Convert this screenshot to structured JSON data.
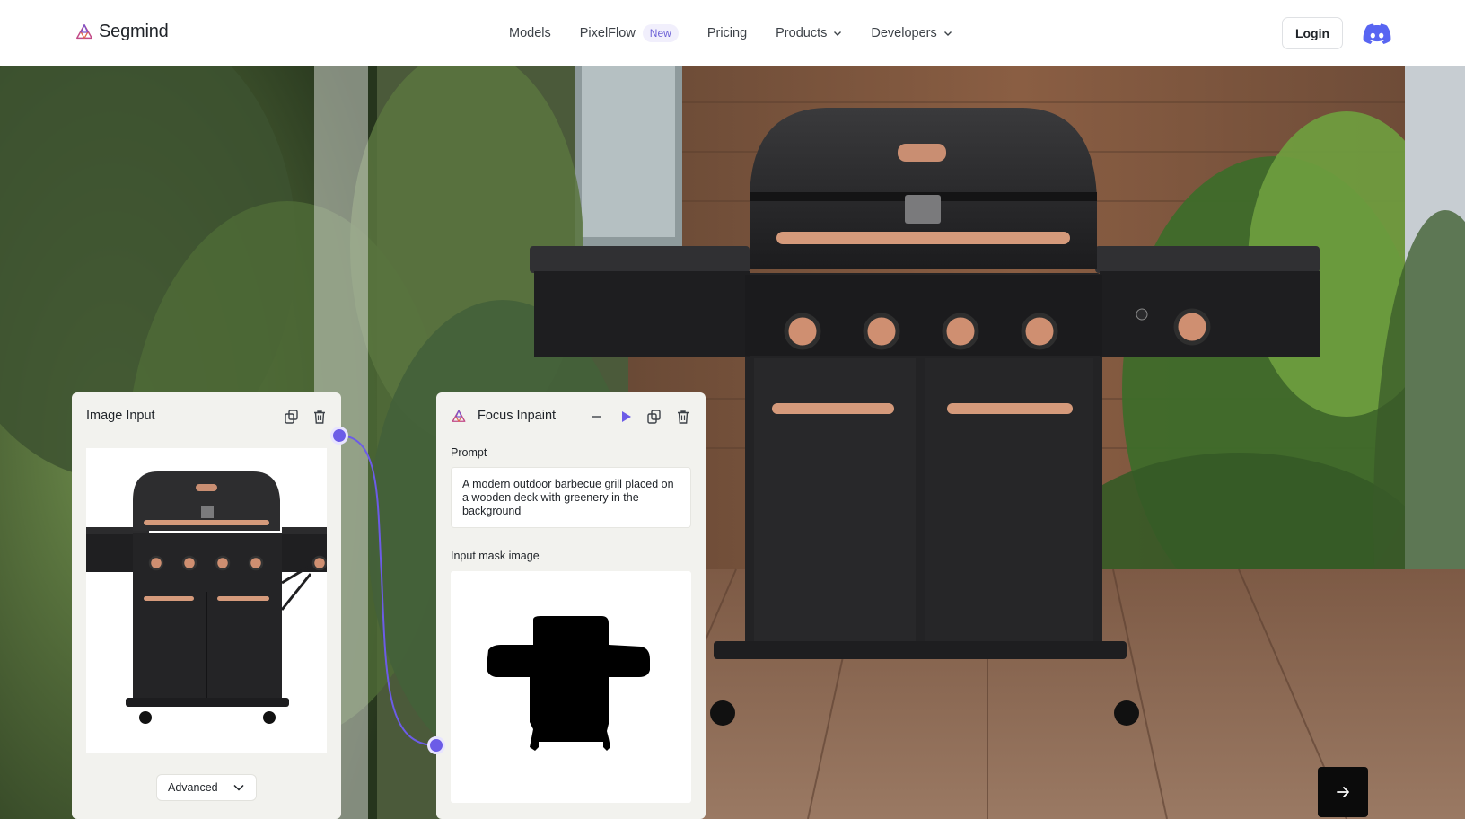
{
  "brand": {
    "name": "Segmind"
  },
  "nav": {
    "models": "Models",
    "pixelflow": "PixelFlow",
    "pixelflow_badge": "New",
    "pricing": "Pricing",
    "products": "Products",
    "developers": "Developers"
  },
  "header": {
    "login": "Login",
    "discord_icon": "discord-icon"
  },
  "image_input": {
    "title": "Image Input",
    "advanced_label": "Advanced"
  },
  "focus_inpaint": {
    "title": "Focus Inpaint",
    "prompt_label": "Prompt",
    "prompt_value": "A modern outdoor barbecue grill placed on a wooden deck with greenery in the background",
    "mask_label": "Input mask image"
  },
  "colors": {
    "accent": "#6c5ce7",
    "card_bg": "#f2f2ee",
    "next_button": "#0b0b0b"
  }
}
